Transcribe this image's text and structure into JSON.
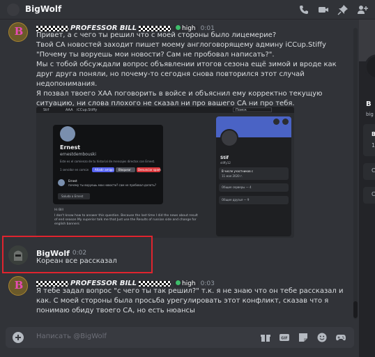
{
  "titlebar": {
    "title": "BigWolf"
  },
  "messages": [
    {
      "author": "PROFESSOR BILL",
      "badge": "high",
      "time": "0:01",
      "lines": [
        "Привет, а с чего ты решил что с моей стороны было лицемерие?",
        "Твой CA новостей заходит пишет моему англоговорящему админу iCCup.Stiffy \"Почему ты воруешь мои новости? Сам не пробовал написать?\".",
        "Мы с тобой обсуждали вопрос объявлении итогов сезона ещё зимой и вроде как друг друга поняли, но почему-то сегодня снова повторился этот случай недопонимания.",
        "Я позвал твоего ХАА поговорить в войсе и объяснил ему корректно текущую ситуацию, ни слова плохого не сказал ни про вашего CA ни про тебя."
      ]
    },
    {
      "author": "BigWolf",
      "time": "0:02",
      "text": "Кореан все рассказал"
    },
    {
      "author": "PROFESSOR BILL",
      "badge": "high",
      "time": "0:03",
      "text": "Я тебе задал вопрос \"с чего ты так решил?\" т.к. я не знаю что он тебе рассказал и как. С моей стороны была просьба урегулировать этот конфликт, сказав что я понимаю обиду твоего CA, но есть нюансы"
    }
  ],
  "screenshot": {
    "top_name": "Stif",
    "top_tab": "AAA",
    "top_channel": "iCCup.Stiffy",
    "search": "Поиск",
    "dm_name": "Ernest",
    "dm_user": "ernestdembouski",
    "dm_desc": "Este es el comienzo de tu historial de mensajes directos con Ernest.",
    "dm_mutual": "1 servidor en común",
    "btn_add": "Añadir amigo",
    "btn_block": "Bloquear",
    "btn_report": "Denunciar spam",
    "dm_msg_author": "Ernest",
    "dm_msg_text": "почему ты воруешь мои новости? сам не пробовал делать?",
    "dm_greet": "Saluda a Ernest",
    "reply_1": "Hi Bill",
    "reply_2": "I don't know how to answer this question. Because the last time I did the news about result of end season My superior talk me that Just use the Results of russian side and change for english banners",
    "profile_name": "Stif",
    "profile_user": "stiffy12",
    "member_since_label": "В числе участников с",
    "member_since": "11 мая 2020 г.",
    "mutual_servers": "Общие серверы — 4",
    "mutual_friends": "Общие друзья — 9"
  },
  "input": {
    "placeholder": "Написать @BigWolf"
  },
  "right_panel": {
    "b1": "B",
    "big": "big",
    "b2": "B",
    "n1": "1",
    "c1": "C",
    "c2": "C"
  },
  "colors": {
    "background": "#313338",
    "highlight_border": "#e0242e",
    "status_green": "#3fbe6b",
    "accent": "#5865f2"
  }
}
